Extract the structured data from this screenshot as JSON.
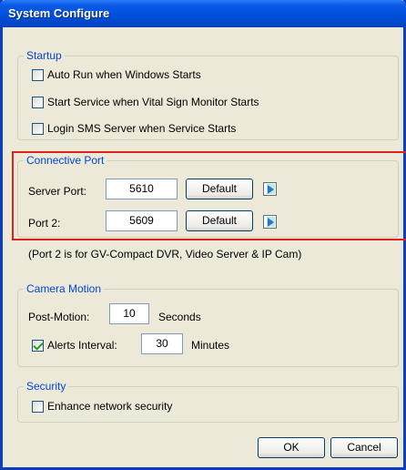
{
  "window": {
    "title": "System Configure"
  },
  "startup": {
    "legend": "Startup",
    "auto_run": {
      "label": "Auto Run when Windows Starts",
      "checked": false
    },
    "start_service": {
      "label": "Start Service when Vital Sign Monitor Starts",
      "checked": false
    },
    "login_sms": {
      "label": "Login SMS Server when Service Starts",
      "checked": false
    }
  },
  "connective_port": {
    "legend": "Connective Port",
    "server_port_label": "Server Port:",
    "server_port_value": "5610",
    "port2_label": "Port 2:",
    "port2_value": "5609",
    "default_label": "Default",
    "note": "(Port 2 is for GV-Compact DVR, Video Server & IP Cam)"
  },
  "camera_motion": {
    "legend": "Camera Motion",
    "post_motion_label": "Post-Motion:",
    "post_motion_value": "10",
    "seconds_label": "Seconds",
    "alerts_label": "Alerts Interval:",
    "alerts_checked": true,
    "alerts_value": "30",
    "minutes_label": "Minutes"
  },
  "security": {
    "legend": "Security",
    "enhance_label": "Enhance network security",
    "enhance_checked": false
  },
  "buttons": {
    "ok": "OK",
    "cancel": "Cancel"
  },
  "colors": {
    "highlight": "#e0211d",
    "title_bar": "#0050dc",
    "legend_text": "#0046d5"
  }
}
